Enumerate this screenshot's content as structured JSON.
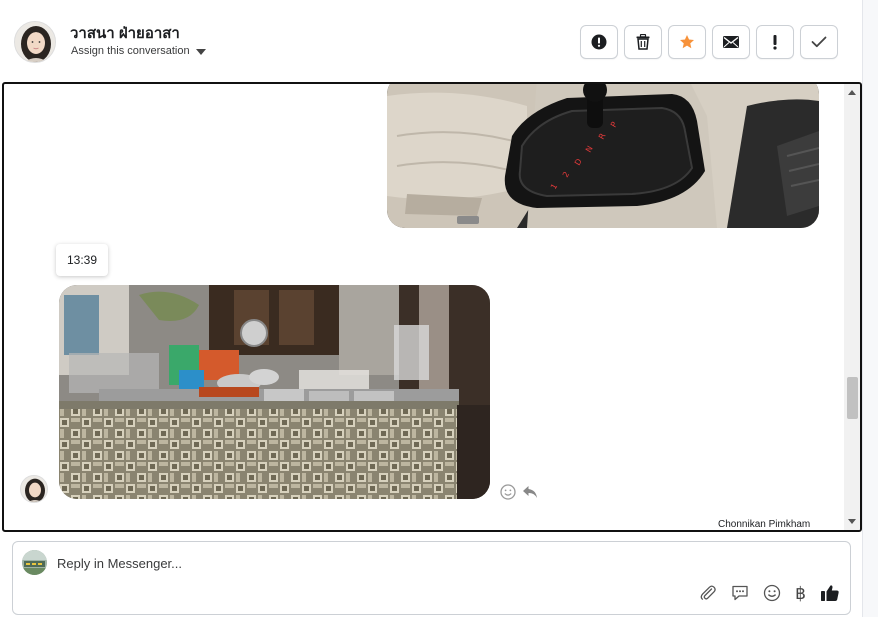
{
  "header": {
    "contact_name": "วาสนา ฝ่ายอาสา",
    "assign_label": "Assign this conversation",
    "actions": [
      {
        "name": "spam-icon",
        "label": "Mark as spam"
      },
      {
        "name": "trash-icon",
        "label": "Delete"
      },
      {
        "name": "star-icon",
        "label": "Star"
      },
      {
        "name": "envelope-icon",
        "label": "Mark as unread"
      },
      {
        "name": "exclamation-icon",
        "label": "Follow up"
      },
      {
        "name": "checkmark-icon",
        "label": "Mark as done"
      }
    ],
    "accent_color": "#f7923a"
  },
  "conversation": {
    "timestamp": "13:39",
    "sender_name": "Chonnikan Pimkham",
    "messages": [
      {
        "type": "image",
        "subject": "car-gear-shift-photo"
      },
      {
        "type": "image",
        "subject": "food-stall-table-photo"
      }
    ]
  },
  "composer": {
    "placeholder": "Reply in Messenger...",
    "value": "",
    "tools": [
      "paperclip-icon",
      "saved-replies-icon",
      "emoji-icon",
      "currency-icon",
      "thumbs-up-icon"
    ],
    "currency_symbol": "฿"
  }
}
